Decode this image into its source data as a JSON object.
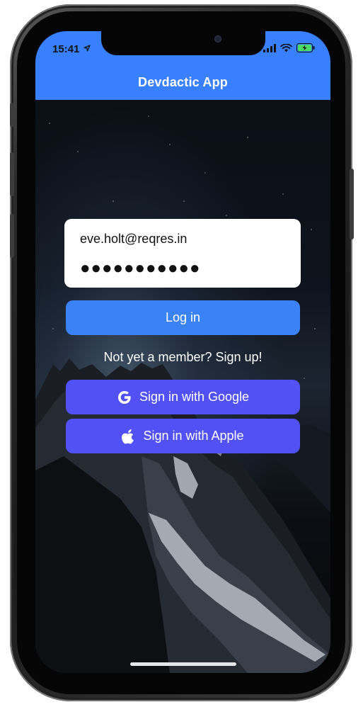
{
  "status_bar": {
    "time": "15:41"
  },
  "toolbar": {
    "title": "Devdactic App"
  },
  "login_form": {
    "email_value": "eve.holt@reqres.in",
    "password_value": "●●●●●●●●●●●"
  },
  "buttons": {
    "login_label": "Log in",
    "google_label": "Sign in with Google",
    "apple_label": "Sign in with Apple"
  },
  "signup_text": "Not yet a member? Sign up!",
  "colors": {
    "toolbar": "#3880ff",
    "primary_button": "#3b82f6",
    "social_button": "#5151f5",
    "battery": "#4cd964"
  },
  "icons": {
    "google": "google-icon",
    "apple": "apple-icon",
    "signal": "signal-icon",
    "wifi": "wifi-icon",
    "battery": "battery-charging-icon",
    "location": "location-arrow-icon"
  }
}
